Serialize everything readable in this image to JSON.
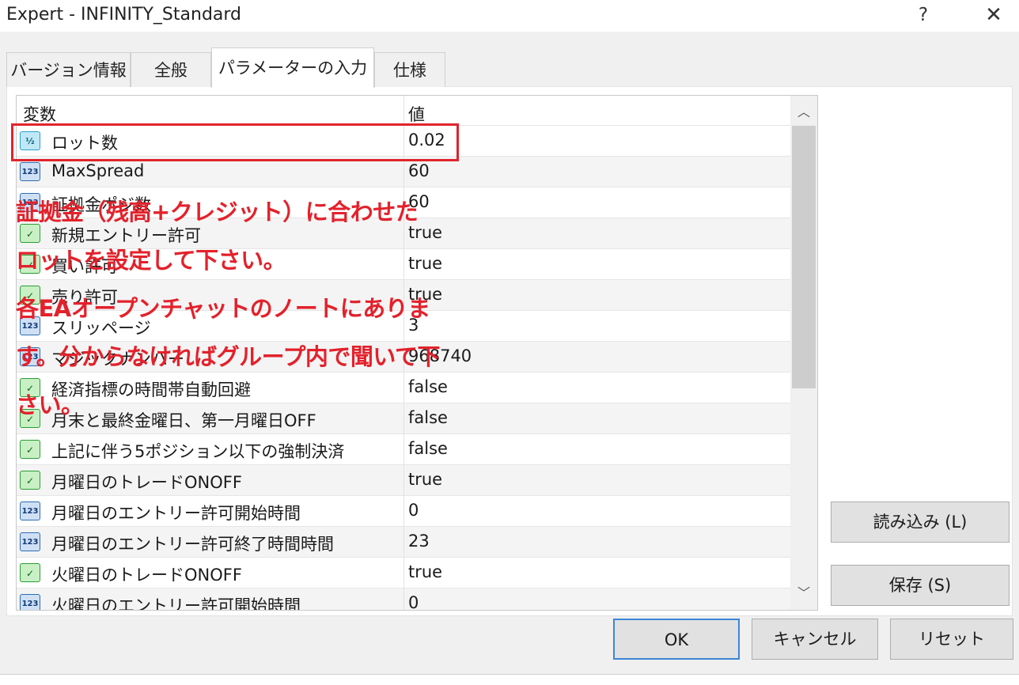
{
  "window": {
    "title": "Expert - INFINITY_Standard",
    "help_label": "?",
    "close_label": "✕"
  },
  "tabs": [
    {
      "label": "バージョン情報"
    },
    {
      "label": "全般"
    },
    {
      "label": "パラメーターの入力"
    },
    {
      "label": "仕様"
    }
  ],
  "grid": {
    "header_name": "変数",
    "header_value": "値",
    "rows": [
      {
        "name": "ロット数",
        "value": "0.02",
        "icon": "half-icon",
        "glyph": "½"
      },
      {
        "name": "MaxSpread",
        "value": "60",
        "icon": "number-icon",
        "glyph": "123"
      },
      {
        "name": "証拠金ポジ数",
        "value": "60",
        "icon": "number-icon",
        "glyph": "123"
      },
      {
        "name": "新規エントリー許可",
        "value": "true",
        "icon": "bool-icon",
        "glyph": "✓"
      },
      {
        "name": "買い許可",
        "value": "true",
        "icon": "bool-icon",
        "glyph": "✓"
      },
      {
        "name": "売り許可",
        "value": "true",
        "icon": "bool-icon",
        "glyph": "✓"
      },
      {
        "name": "スリッページ",
        "value": "3",
        "icon": "number-icon",
        "glyph": "123"
      },
      {
        "name": "マジックナンバー",
        "value": "968740",
        "icon": "number-icon",
        "glyph": "123"
      },
      {
        "name": "経済指標の時間帯自動回避",
        "value": "false",
        "icon": "bool-icon",
        "glyph": "✓"
      },
      {
        "name": "月末と最終金曜日、第一月曜日OFF",
        "value": "false",
        "icon": "bool-icon",
        "glyph": "✓"
      },
      {
        "name": "上記に伴う5ポジション以下の強制決済",
        "value": "false",
        "icon": "bool-icon",
        "glyph": "✓"
      },
      {
        "name": "月曜日のトレードONOFF",
        "value": "true",
        "icon": "bool-icon",
        "glyph": "✓"
      },
      {
        "name": "月曜日のエントリー許可開始時間",
        "value": "0",
        "icon": "number-icon",
        "glyph": "123"
      },
      {
        "name": "月曜日のエントリー許可終了時間時間",
        "value": "23",
        "icon": "number-icon",
        "glyph": "123"
      },
      {
        "name": "火曜日のトレードONOFF",
        "value": "true",
        "icon": "bool-icon",
        "glyph": "✓"
      },
      {
        "name": "火曜日のエントリー許可開始時間",
        "value": "0",
        "icon": "number-icon",
        "glyph": "123"
      }
    ]
  },
  "annotation": {
    "lines": [
      "証拠金（残高+クレジット）に合わせた",
      "ロットを設定して下さい。",
      "各EAオープンチャットのノートにありま",
      "す。分からなければグループ内で聞いて下",
      "さい。"
    ]
  },
  "buttons": {
    "load": "読み込み (L)",
    "save": "保存 (S)",
    "ok": "OK",
    "cancel": "キャンセル",
    "reset": "リセット"
  },
  "colors": {
    "annotation_red": "#e3212b",
    "focus_blue": "#3c85d6"
  }
}
